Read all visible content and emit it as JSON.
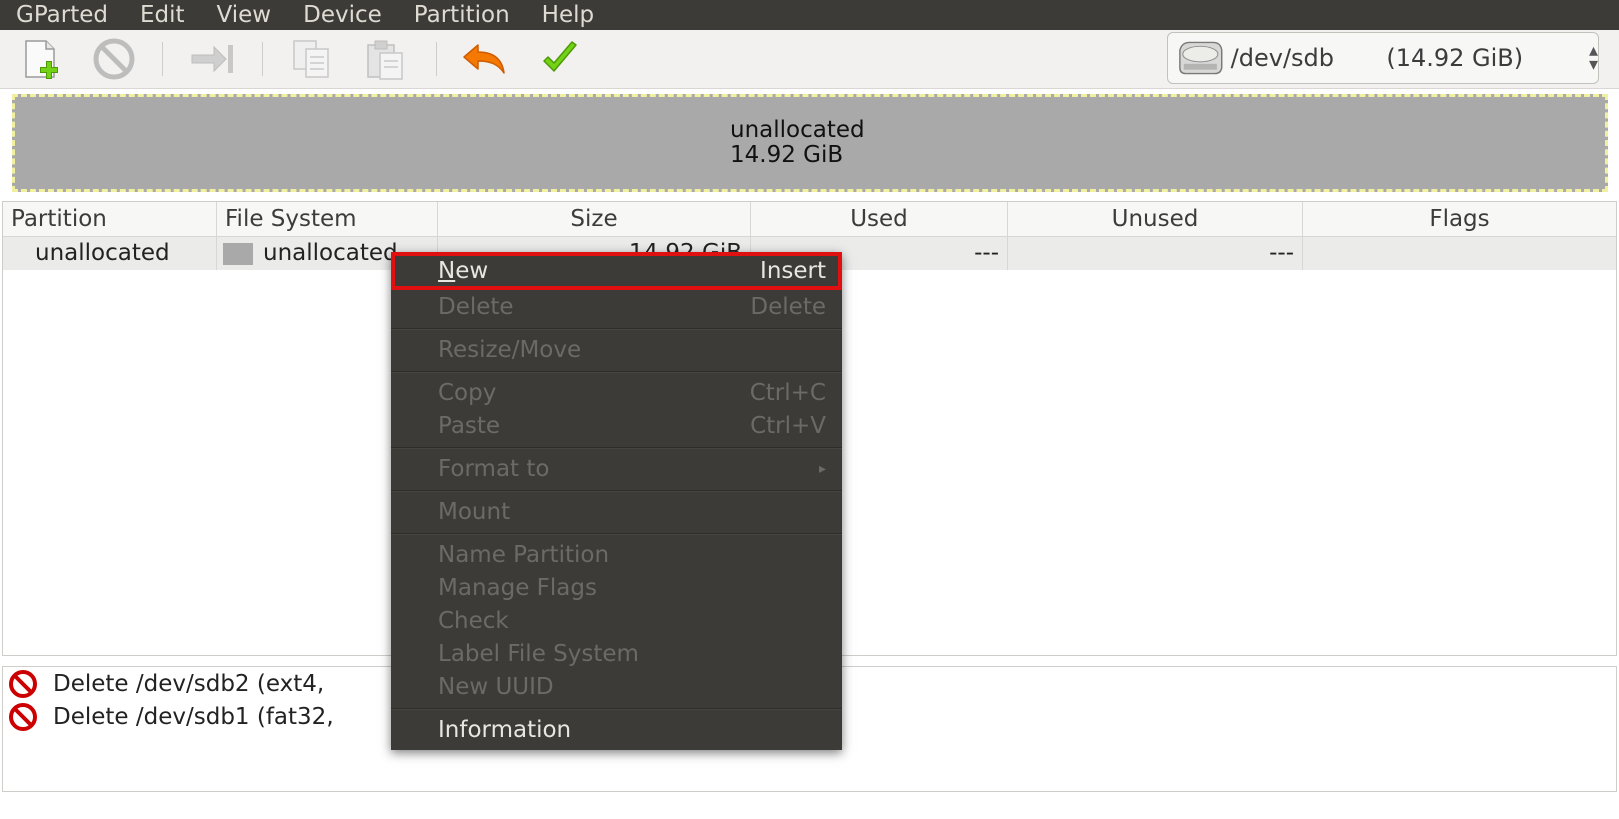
{
  "menubar": {
    "items": [
      "GParted",
      "Edit",
      "View",
      "Device",
      "Partition",
      "Help"
    ]
  },
  "toolbar": {
    "buttons": [
      {
        "name": "new-partition",
        "icon": "new-document-icon",
        "enabled": true
      },
      {
        "name": "delete-partition",
        "icon": "no-entry-icon",
        "enabled": false
      },
      {
        "name": "resize-move",
        "icon": "arrow-to-bar-icon",
        "enabled": false
      },
      {
        "name": "copy",
        "icon": "copy-icon",
        "enabled": false
      },
      {
        "name": "paste",
        "icon": "paste-icon",
        "enabled": false
      },
      {
        "name": "undo",
        "icon": "undo-arrow-icon",
        "enabled": true
      },
      {
        "name": "apply",
        "icon": "checkmark-icon",
        "enabled": true
      }
    ],
    "device": {
      "path": "/dev/sdb",
      "size": "(14.92 GiB)"
    }
  },
  "diskmap": {
    "label": "unallocated",
    "size": "14.92 GiB"
  },
  "table": {
    "headers": [
      "Partition",
      "File System",
      "Size",
      "Used",
      "Unused",
      "Flags"
    ],
    "rows": [
      {
        "partition": "unallocated",
        "filesystem": "unallocated",
        "size": "14.92 GiB",
        "used": "---",
        "unused": "---",
        "flags": ""
      }
    ]
  },
  "operations": [
    {
      "icon": "no-entry-icon",
      "text": "Delete /dev/sdb2 (ext4,"
    },
    {
      "icon": "no-entry-icon",
      "text": "Delete /dev/sdb1 (fat32,"
    }
  ],
  "context_menu": {
    "items": [
      {
        "label": "New",
        "mnemonic": "N",
        "rest": "ew",
        "accel": "Insert",
        "enabled": true,
        "highlighted": true
      },
      {
        "label": "Delete",
        "accel": "Delete",
        "enabled": false
      },
      {
        "label": "Resize/Move",
        "accel": "",
        "enabled": false
      },
      {
        "label": "Copy",
        "accel": "Ctrl+C",
        "enabled": false
      },
      {
        "label": "Paste",
        "accel": "Ctrl+V",
        "enabled": false
      },
      {
        "label": "Format to",
        "accel": "▸",
        "enabled": false
      },
      {
        "label": "Mount",
        "accel": "",
        "enabled": false
      },
      {
        "label": "Name Partition",
        "accel": "",
        "enabled": false
      },
      {
        "label": "Manage Flags",
        "accel": "",
        "enabled": false
      },
      {
        "label": "Check",
        "accel": "",
        "enabled": false
      },
      {
        "label": "Label File System",
        "accel": "",
        "enabled": false
      },
      {
        "label": "New UUID",
        "accel": "",
        "enabled": false
      },
      {
        "label": "Information",
        "accel": "",
        "enabled": true
      }
    ]
  },
  "colors": {
    "menubar_bg": "#3c3b37",
    "menu_text": "#dfdbd2",
    "highlight_border": "#e01010",
    "unallocated_fill": "#a9a9a9"
  }
}
